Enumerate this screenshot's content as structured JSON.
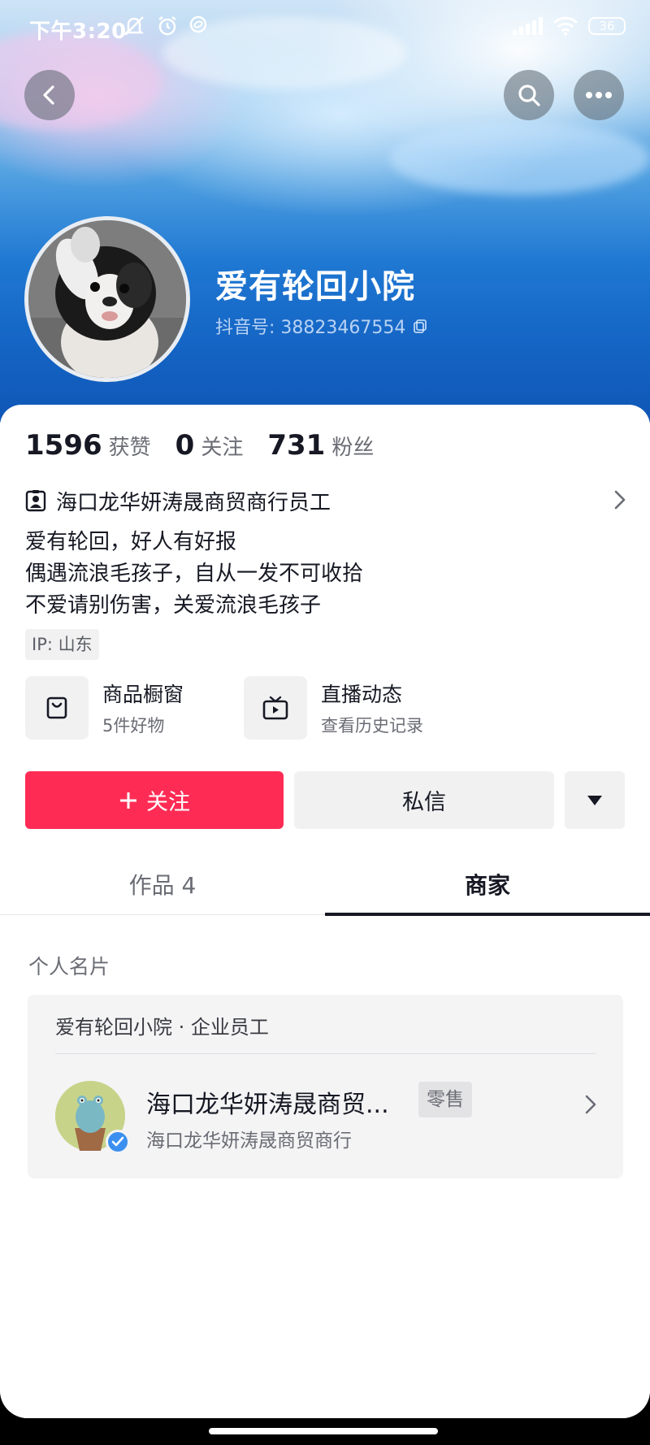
{
  "status_bar": {
    "time": "下午3:20",
    "battery": "36"
  },
  "profile": {
    "name": "爱有轮回小院",
    "douyin_id": "抖音号: 38823467554"
  },
  "stats": [
    {
      "value": "1596",
      "label": "获赞"
    },
    {
      "value": "0",
      "label": "关注"
    },
    {
      "value": "731",
      "label": "粉丝"
    }
  ],
  "job": "海口龙华妍涛晟商贸商行员工",
  "bio": [
    "爱有轮回，好人有好报",
    "偶遇流浪毛孩子，自从一发不可收拾",
    "不爱请别伤害，关爱流浪毛孩子"
  ],
  "ip": "IP: 山东",
  "features": [
    {
      "title": "商品橱窗",
      "subtitle": "5件好物",
      "icon": "shopping-bag-icon"
    },
    {
      "title": "直播动态",
      "subtitle": "查看历史记录",
      "icon": "tv-play-icon"
    }
  ],
  "actions": {
    "follow": "关注",
    "message": "私信"
  },
  "tabs": {
    "works": "作品 4",
    "merchant": "商家"
  },
  "business_card": {
    "section_title": "个人名片",
    "header": "爱有轮回小院 · 企业员工",
    "company_name": "海口龙华妍涛晟商贸...",
    "tag": "零售",
    "company_full": "海口龙华妍涛晟商贸商行"
  },
  "colors": {
    "follow_button": "#fe2c55",
    "verified_badge": "#3b8ff0",
    "text_primary": "#161823"
  }
}
